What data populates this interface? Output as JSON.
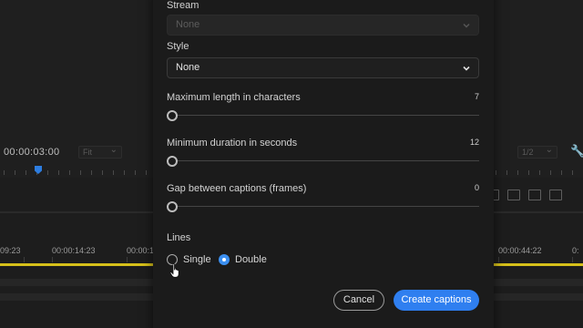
{
  "background": {
    "timecode": "00:00:03:00",
    "fit_label": "Fit",
    "resolution_label": "1/2",
    "timeline_times": [
      "09:23",
      "00:00:14:23",
      "00:00:19",
      "00:00:44:22",
      "0:"
    ]
  },
  "dialog": {
    "stream": {
      "label": "Stream",
      "value": "None"
    },
    "style": {
      "label": "Style",
      "value": "None"
    },
    "sliders": [
      {
        "label": "Maximum length in characters",
        "value": "7"
      },
      {
        "label": "Minimum duration in seconds",
        "value": "12"
      },
      {
        "label": "Gap between captions (frames)",
        "value": "0"
      }
    ],
    "lines": {
      "label": "Lines",
      "options": [
        "Single",
        "Double"
      ],
      "selected": "Double"
    },
    "buttons": {
      "cancel": "Cancel",
      "create": "Create captions"
    }
  },
  "colors": {
    "accent": "#2f7ff0",
    "timeline_bar": "#d6c01a",
    "playhead": "#2d7de0"
  }
}
